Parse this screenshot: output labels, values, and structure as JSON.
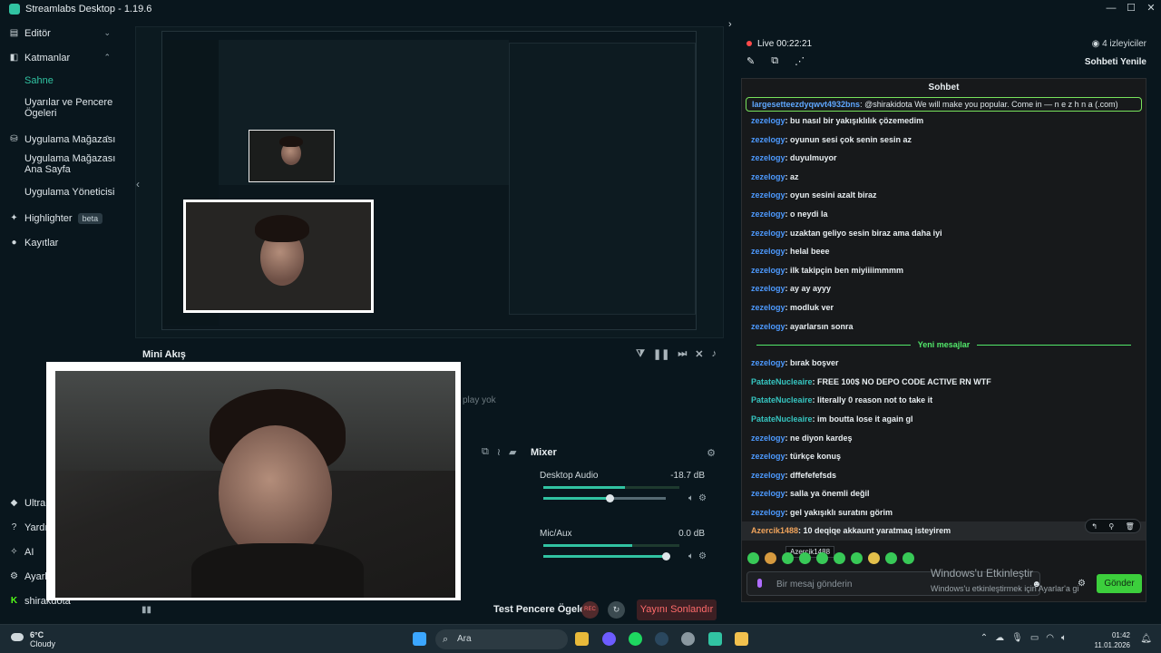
{
  "app": {
    "title": "Streamlabs Desktop - 1.19.6"
  },
  "sidebar": {
    "items": [
      {
        "label": "Editör"
      },
      {
        "label": "Katmanlar"
      },
      {
        "label": "Sahne"
      },
      {
        "label": "Uyarılar ve Pencere Ögeleri"
      },
      {
        "label": "Uygulama Mağazası"
      },
      {
        "label": "Uygulama Mağazası Ana Sayfa"
      },
      {
        "label": "Uygulama Yöneticisi"
      },
      {
        "label": "Highlighter",
        "badge": "beta"
      },
      {
        "label": "Kayıtlar"
      },
      {
        "label": "Ultra"
      },
      {
        "label": "Yardım"
      },
      {
        "label": "AI"
      },
      {
        "label": "Ayarlar"
      },
      {
        "label": "shirakdota"
      }
    ]
  },
  "mini_flow": {
    "title": "Mini Akış",
    "empty_text": "play yok"
  },
  "mixer": {
    "title": "Mixer",
    "channels": [
      {
        "name": "Desktop Audio",
        "db": "-18.7 dB",
        "level": 0.6,
        "volume": 0.54
      },
      {
        "name": "Mic/Aux",
        "db": "0.0 dB",
        "level": 0.65,
        "volume": 1.0
      }
    ]
  },
  "stream_controls": {
    "test_label": "Test Pencere Ögeleri",
    "rec_label": "REC",
    "end_button": "Yayını Sonlandır"
  },
  "chat_header": {
    "live": "Live",
    "time": "00:22:21",
    "viewers": "4 izleyiciler",
    "refresh": "Sohbeti Yenile"
  },
  "chat": {
    "title": "Sohbet",
    "pinned": {
      "user": "largesetteezdyqwvt4932bns",
      "text": ": @shirakidota We will make you popular. Come in — n e z h n a (.com)"
    },
    "messages": [
      {
        "user": "zezelogy",
        "text": ": bu nasıl bir yakışıklılık çözemedim",
        "cls": "u1"
      },
      {
        "user": "zezelogy",
        "text": ": oyunun sesi çok senin sesin az",
        "cls": "u1"
      },
      {
        "user": "zezelogy",
        "text": ": duyulmuyor",
        "cls": "u1"
      },
      {
        "user": "zezelogy",
        "text": ": az",
        "cls": "u1"
      },
      {
        "user": "zezelogy",
        "text": ": oyun sesini azalt biraz",
        "cls": "u1"
      },
      {
        "user": "zezelogy",
        "text": ": o neydi la",
        "cls": "u1"
      },
      {
        "user": "zezelogy",
        "text": ": uzaktan geliyo sesin biraz ama daha iyi",
        "cls": "u1"
      },
      {
        "user": "zezelogy",
        "text": ": helal beee",
        "cls": "u1"
      },
      {
        "user": "zezelogy",
        "text": ": ilk takipçin ben miyiiiimmmm",
        "cls": "u1"
      },
      {
        "user": "zezelogy",
        "text": ": ay ay ayyy",
        "cls": "u1"
      },
      {
        "user": "zezelogy",
        "text": ": modluk ver",
        "cls": "u1"
      },
      {
        "user": "zezelogy",
        "text": ": ayarlarsın sonra",
        "cls": "u1"
      }
    ],
    "new_messages_label": "Yeni mesajlar",
    "new_messages": [
      {
        "user": "zezelogy",
        "text": ": bırak boşver",
        "cls": "u1"
      },
      {
        "user": "PatateNucleaire",
        "text": ": FREE 100$ NO DEPO CODE ACTIVE RN WTF",
        "cls": "u2"
      },
      {
        "user": "PatateNucleaire",
        "text": ": literally 0 reason not to take it",
        "cls": "u2"
      },
      {
        "user": "PatateNucleaire",
        "text": ": im boutta lose it again gl",
        "cls": "u2"
      },
      {
        "user": "zezelogy",
        "text": ": ne diyon kardeş",
        "cls": "u1"
      },
      {
        "user": "zezelogy",
        "text": ": türkçe konuş",
        "cls": "u1"
      },
      {
        "user": "zezelogy",
        "text": ": dffefefefsds",
        "cls": "u1"
      },
      {
        "user": "zezelogy",
        "text": ": salla ya önemli değil",
        "cls": "u1"
      },
      {
        "user": "zezelogy",
        "text": ": gel yakışıklı suratını görim",
        "cls": "u1"
      },
      {
        "user": "Azercik1488",
        "text": ": 10 deqiqe akkaunt yaratmaq isteyirem",
        "cls": "u3"
      }
    ],
    "tooltip": "Azercik1488",
    "input_placeholder": "Bir mesaj gönderin",
    "send": "Gönder"
  },
  "windows_activation": {
    "title": "Windows'u Etkinleştir",
    "subtitle": "Windows'u etkinleştirmek için Ayarlar'a gi"
  },
  "taskbar": {
    "weather_temp": "6°C",
    "weather_desc": "Cloudy",
    "search": "Ara",
    "time": "01:42",
    "date": "11.01.2026"
  }
}
